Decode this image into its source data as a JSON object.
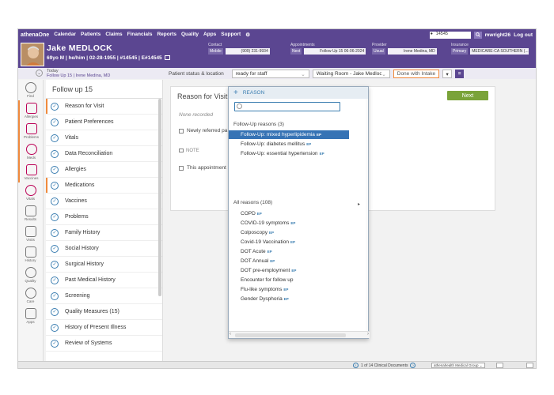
{
  "topbar": {
    "logo": "athenaOne",
    "nav": [
      "Calendar",
      "Patients",
      "Claims",
      "Financials",
      "Reports",
      "Quality",
      "Apps",
      "Support"
    ],
    "search_value": "14545",
    "user": "mwright26",
    "logout": "Log out"
  },
  "patient": {
    "name": "Jake MEDLOCK",
    "demographics": "69yo M | he/him | 02-28-1955 | #14545 | E#14545",
    "today_label": "Today",
    "followup_line": "Follow Up 15 | Irene Medina, MD",
    "contact_label": "Contact",
    "contact_type": "Mobile",
    "contact_phone": "(909) 231-9934",
    "appt_label": "Appointments",
    "appt_type": "Next",
    "appt_value": "Follow Up 15 06-06-2024",
    "provider_label": "Provider",
    "provider_type": "Usual",
    "provider_value": "Irene Medina, MD",
    "insurance_label": "Insurance",
    "insurance_type": "Primary",
    "insurance_value": "MEDICARE-CA SOUTHERN (..."
  },
  "status": {
    "label": "Patient status & location",
    "status_value": "ready for staff",
    "room_value": "Waiting Room - Jake Medlocl",
    "done_button": "Done with Intake"
  },
  "rail": [
    {
      "label": "Find",
      "icon": "search-icon"
    },
    {
      "label": "Allergies",
      "icon": "hand-icon"
    },
    {
      "label": "Problems",
      "icon": "problems-icon"
    },
    {
      "label": "Meds",
      "icon": "pill-icon"
    },
    {
      "label": "Vaccines",
      "icon": "syringe-icon"
    },
    {
      "label": "Vitals",
      "icon": "heart-icon"
    },
    {
      "label": "Results",
      "icon": "flask-icon"
    },
    {
      "label": "Visits",
      "icon": "calendar-icon"
    },
    {
      "label": "History",
      "icon": "clipboard-icon"
    },
    {
      "label": "Quality",
      "icon": "ribbon-icon"
    },
    {
      "label": "Care",
      "icon": "care-icon"
    },
    {
      "label": "Apps",
      "icon": "grid-icon"
    }
  ],
  "chartnav": {
    "title": "Follow up 15",
    "items": [
      "Reason for Visit",
      "Patient Preferences",
      "Vitals",
      "Data Reconciliation",
      "Allergies",
      "Medications",
      "Vaccines",
      "Problems",
      "Family History",
      "Social History",
      "Surgical History",
      "Past Medical History",
      "Screening",
      "Quality Measures  (15)",
      "History of Present Illness",
      "Review of Systems"
    ]
  },
  "main": {
    "title": "Reason for Visit",
    "none_recorded": "None recorded",
    "newly_referred": "Newly referred pa",
    "note": "NOTE",
    "this_appointment": "This appointment",
    "next_button": "Next"
  },
  "dropdown": {
    "header": "REASON",
    "followup_section": "Follow-Up reasons (3)",
    "followup_options": [
      "Follow-Up: mixed hyperlipidemia",
      "Follow-Up: diabetes mellitus",
      "Follow-Up: essential hypertension"
    ],
    "all_section": "All reasons (108)",
    "all_options": [
      "COPD",
      "COVID-19 symptoms",
      "Colposcopy",
      "Covid-19 Vaccination",
      "DOT Acute",
      "DOT Annual",
      "DOT pre-employment",
      "Encounter for follow up",
      "Flu-like symptoms",
      "Gender Dysphoria"
    ],
    "ep_tag": "EP"
  },
  "bottombar": {
    "docs": "1 of 14 Clinical Documents",
    "dept": "athenahealth Medical Group"
  },
  "colors": {
    "brand": "#5b4691",
    "highlight": "#3673b5",
    "next": "#7aa339",
    "accent": "#f08a3c"
  }
}
